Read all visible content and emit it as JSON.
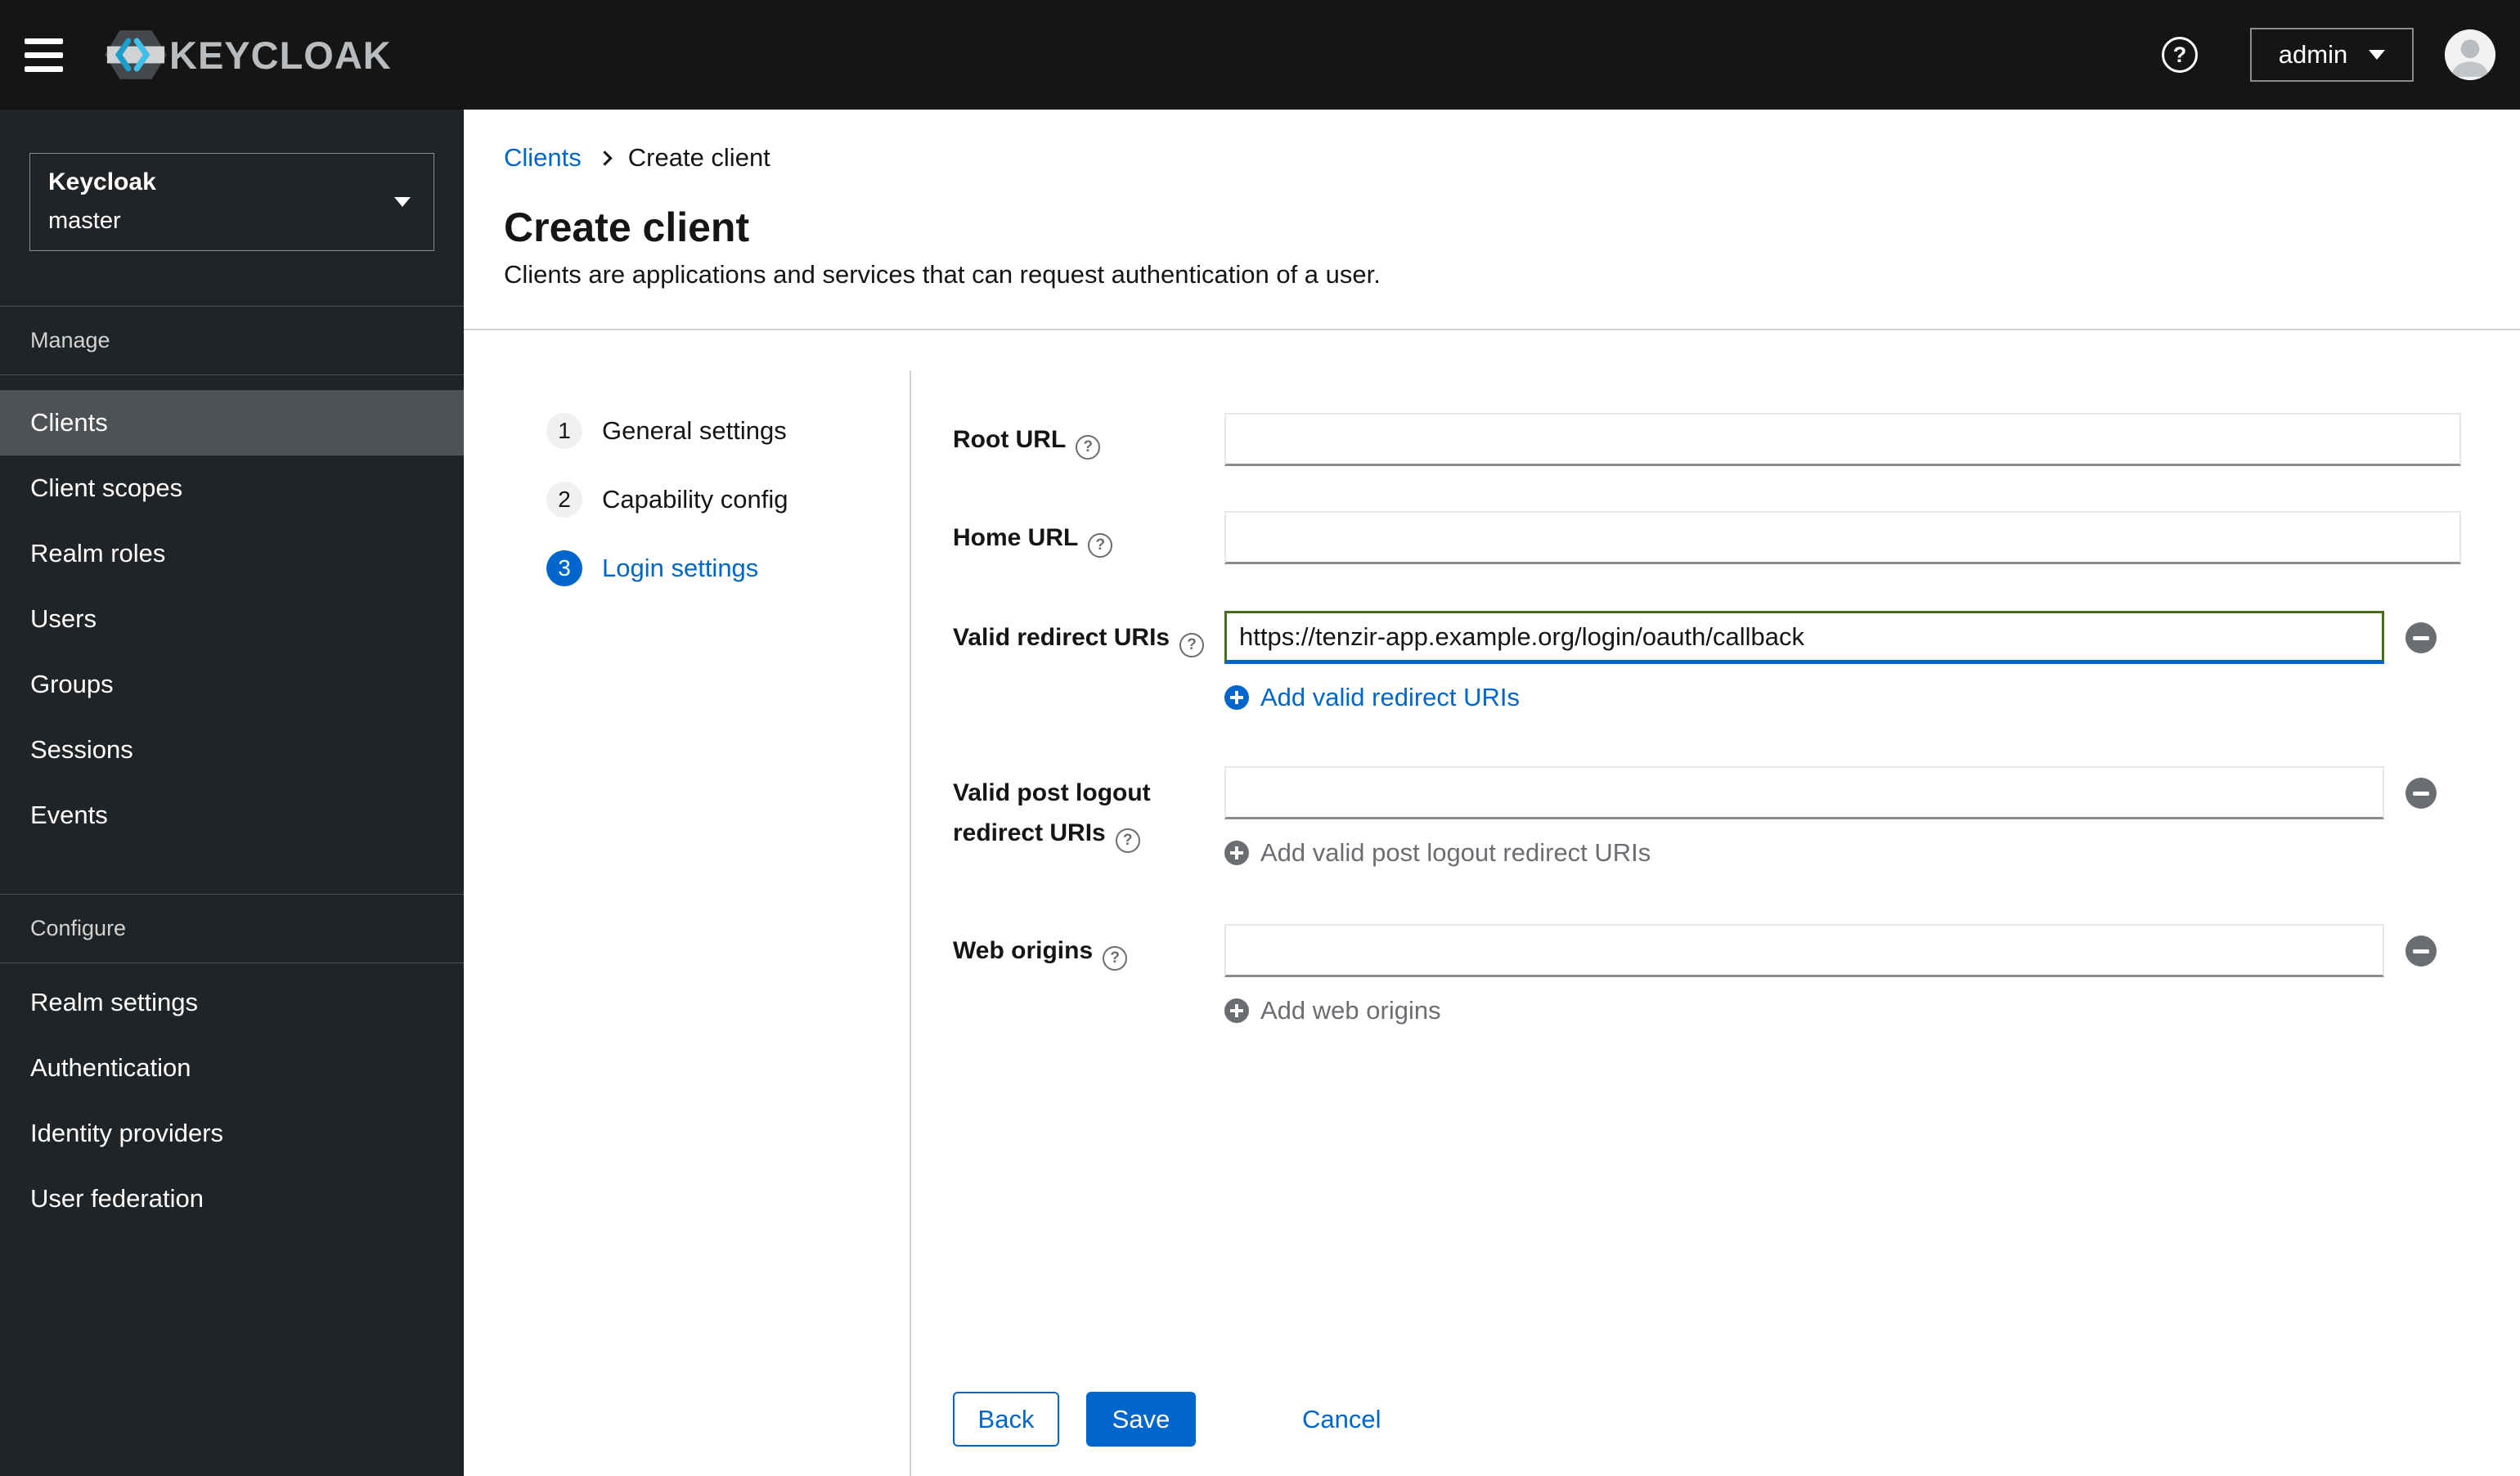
{
  "masthead": {
    "logo_text": "KEYCLOAK",
    "user_menu": {
      "label": "admin"
    }
  },
  "sidebar": {
    "realm_selector": {
      "realm_label": "Keycloak",
      "current_realm": "master"
    },
    "sections": [
      {
        "title": "Manage",
        "items": [
          {
            "label": "Clients",
            "current": true
          },
          {
            "label": "Client scopes",
            "current": false
          },
          {
            "label": "Realm roles",
            "current": false
          },
          {
            "label": "Users",
            "current": false
          },
          {
            "label": "Groups",
            "current": false
          },
          {
            "label": "Sessions",
            "current": false
          },
          {
            "label": "Events",
            "current": false
          }
        ]
      },
      {
        "title": "Configure",
        "items": [
          {
            "label": "Realm settings",
            "current": false
          },
          {
            "label": "Authentication",
            "current": false
          },
          {
            "label": "Identity providers",
            "current": false
          },
          {
            "label": "User federation",
            "current": false
          }
        ]
      }
    ]
  },
  "breadcrumb": {
    "items": [
      {
        "label": "Clients"
      },
      {
        "label": "Create client"
      }
    ]
  },
  "page": {
    "title": "Create client",
    "description": "Clients are applications and services that can request authentication of a user."
  },
  "wizard": {
    "steps": [
      {
        "number": "1",
        "label": "General settings",
        "active": false
      },
      {
        "number": "2",
        "label": "Capability config",
        "active": false
      },
      {
        "number": "3",
        "label": "Login settings",
        "active": true
      }
    ]
  },
  "form": {
    "fields": {
      "root_url": {
        "label": "Root URL",
        "value": ""
      },
      "home_url": {
        "label": "Home URL",
        "value": ""
      },
      "valid_redirect_uris": {
        "label": "Valid redirect URIs",
        "value": "https://tenzir-app.example.org/login/oauth/callback",
        "add_label": "Add valid redirect URIs"
      },
      "valid_post_logout_redirect_uris": {
        "label": "Valid post logout redirect URIs",
        "value": "",
        "add_label": "Add valid post logout redirect URIs"
      },
      "web_origins": {
        "label": "Web origins",
        "value": "",
        "add_label": "Add web origins"
      }
    },
    "actions": {
      "back": "Back",
      "save": "Save",
      "cancel": "Cancel"
    }
  },
  "colors": {
    "header_bg": "#151515",
    "sidebar_bg": "#212427",
    "selected_nav_bg": "#4f5255",
    "primary_blue": "#0066cc",
    "success_green_border": "#466e1e",
    "muted_gray": "#6a6e73",
    "divider_gray": "#d2d2d2"
  }
}
